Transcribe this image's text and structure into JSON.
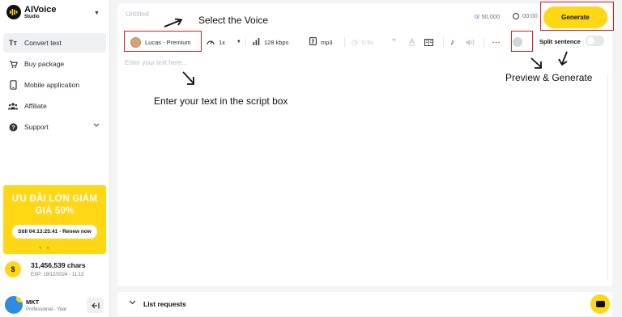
{
  "brand": {
    "name": "AIVoice",
    "sub": "Studio"
  },
  "sidebar": {
    "items": [
      {
        "label": "Convert text",
        "icon": "text-icon",
        "active": true
      },
      {
        "label": "Buy package",
        "icon": "cart-icon"
      },
      {
        "label": "Mobile application",
        "icon": "phone-icon"
      },
      {
        "label": "Affiliate",
        "icon": "users-icon"
      },
      {
        "label": "Support",
        "icon": "help-icon"
      }
    ]
  },
  "promo": {
    "line1": "ƯU ĐÃI LỚN GIẢM",
    "line2": "GIÁ 50%",
    "cta": "Still 04:13:25:41 - Renew now"
  },
  "credits": {
    "chars": "31,456,539 chars",
    "exp": "EXP: 19/12/2024 - 11:13"
  },
  "user": {
    "name": "MKT",
    "plan": "Professional - Year"
  },
  "editor": {
    "title_placeholder": "Untitled",
    "counter_current": "0",
    "counter_max": "/ 50,000",
    "timer": "00:00",
    "generate_label": "Generate",
    "text_placeholder": "Enter your text here...",
    "split_label": "Split sentence"
  },
  "toolbar": {
    "voice": "Lucas - Premium",
    "speed": "1x",
    "bitrate": "128 kbps",
    "format": "mp3",
    "pause": "0.5s"
  },
  "annotations": {
    "select_voice": "Select the Voice",
    "enter_text": "Enter your text in the script box",
    "preview_generate": "Preview & Generate"
  },
  "list": {
    "label": "List requests"
  },
  "colors": {
    "accent": "#ffd714",
    "annotation": "#e11d1d"
  }
}
